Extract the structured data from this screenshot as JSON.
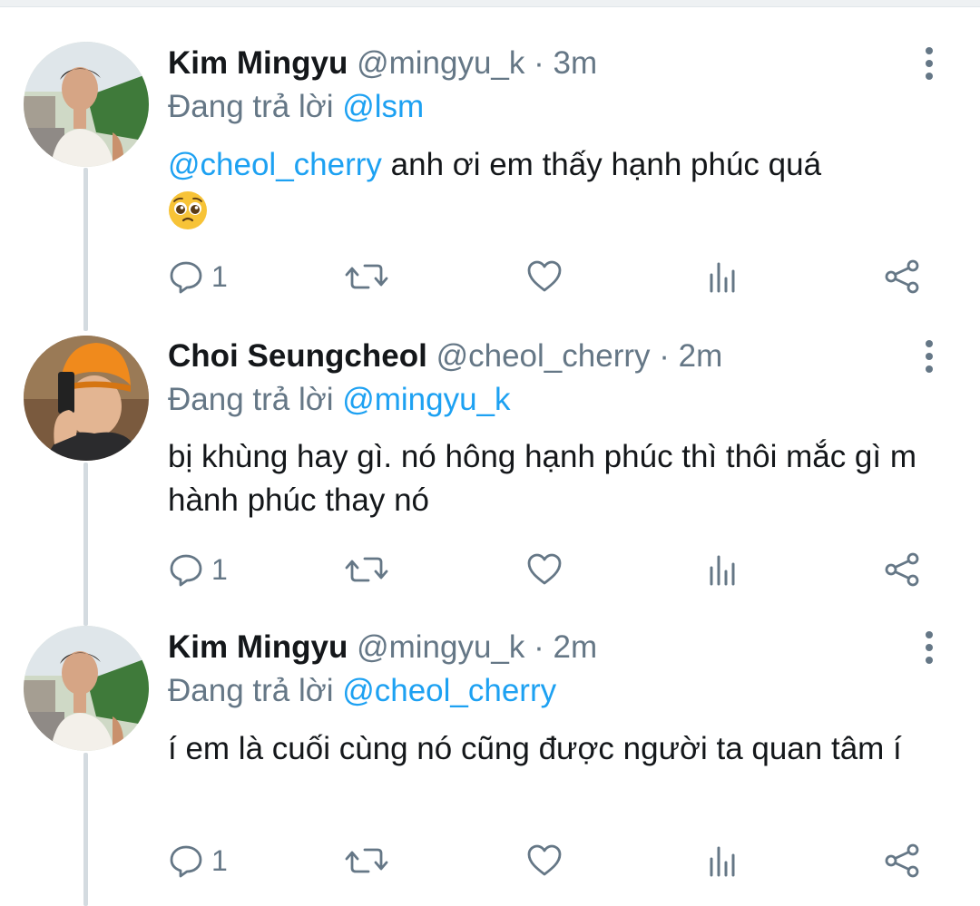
{
  "tweets": [
    {
      "name": "Kim Mingyu",
      "handle": "@mingyu_k",
      "separator": "·",
      "time": "3m",
      "reply_prefix": "Đang trả lời",
      "reply_to": "@lsm",
      "mention": "@cheol_cherry",
      "text": " anh ơi em thấy hạnh phúc quá",
      "emoji": "pleading-face-emoji",
      "reply_count": "1"
    },
    {
      "name": "Choi Seungcheol",
      "handle": "@cheol_cherry",
      "separator": "·",
      "time": "2m",
      "reply_prefix": "Đang trả lời",
      "reply_to": "@mingyu_k",
      "text": "bị khùng hay gì. nó hông hạnh phúc thì thôi mắc gì m hành phúc thay nó",
      "reply_count": "1"
    },
    {
      "name": "Kim Mingyu",
      "handle": "@mingyu_k",
      "separator": "·",
      "time": "2m",
      "reply_prefix": "Đang trả lời",
      "reply_to": "@cheol_cherry",
      "text": "í em là cuối cùng nó cũng được người ta quan tâm í",
      "reply_count": "1"
    }
  ],
  "icons": [
    "reply-icon",
    "retweet-icon",
    "like-icon",
    "analytics-icon",
    "share-icon",
    "more-options-icon"
  ],
  "colors": {
    "link": "#1da1f2",
    "secondary": "#657786",
    "text": "#14171a",
    "thread_line": "#d4dbe0"
  }
}
